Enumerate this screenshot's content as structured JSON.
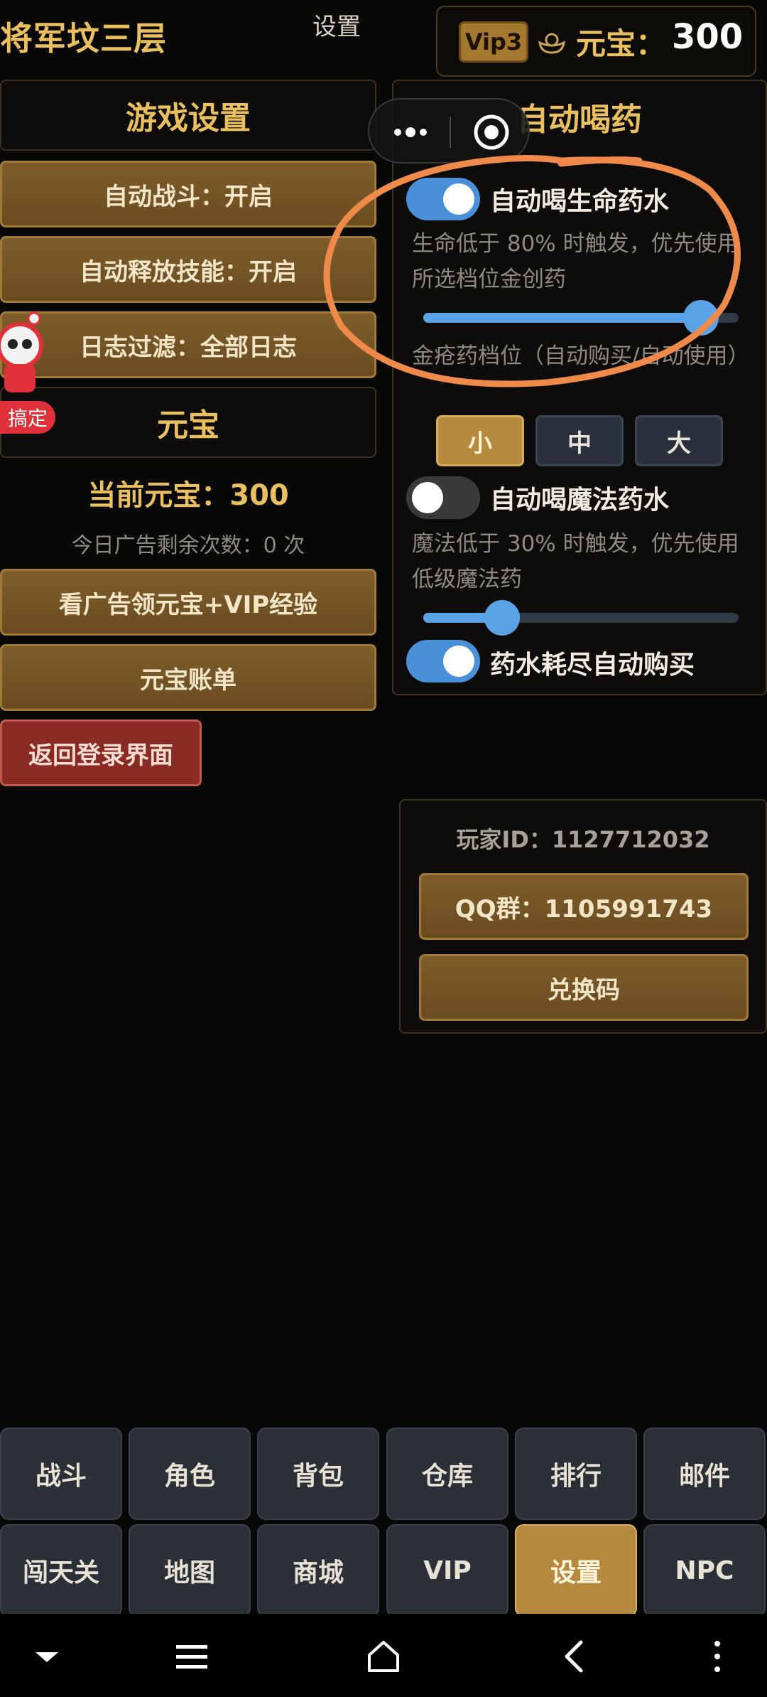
{
  "header": {
    "location": "将军坟三层",
    "tab_title": "设置",
    "vip_badge": "Vip3",
    "ingot_label": "元宝：",
    "ingot_value": "300"
  },
  "game_settings": {
    "title": "游戏设置",
    "auto_battle": "自动战斗：开启",
    "auto_skill": "自动释放技能：开启",
    "log_filter": "日志过滤：全部日志"
  },
  "mascot": {
    "tag": "搞定"
  },
  "ingot_panel": {
    "title": "元宝",
    "current": "当前元宝：300",
    "ads_left": "今日广告剩余次数：0 次",
    "watch_ad": "看广告领元宝+VIP经验",
    "ledger": "元宝账单"
  },
  "return_login": "返回登录界面",
  "auto_potion": {
    "title": "自动喝药",
    "hp": {
      "label": "自动喝生命药水",
      "on": true,
      "desc": "生命低于 80% 时触发，优先使用所选档位金创药",
      "slider_percent": 88
    },
    "tier_label": "金疮药档位（自动购买/自动使用）",
    "tiers": [
      "小",
      "中",
      "大"
    ],
    "tier_selected": "小",
    "mp": {
      "label": "自动喝魔法药水",
      "on": false,
      "desc": "魔法低于 30% 时触发，优先使用低级魔法药",
      "slider_percent": 25
    },
    "auto_buy": {
      "label": "药水耗尽自动购买",
      "on": true
    }
  },
  "account": {
    "player_id": "玩家ID：1127712032",
    "qq_group": "QQ群：1105991743",
    "redeem": "兑换码"
  },
  "nav": {
    "row1": [
      "战斗",
      "角色",
      "背包",
      "仓库",
      "排行",
      "邮件"
    ],
    "row2": [
      "闯天关",
      "地图",
      "商城",
      "VIP",
      "设置",
      "NPC"
    ],
    "active": "设置"
  },
  "colors": {
    "gold_text": "#e9bf5f",
    "accent_blue": "#5aa3e6",
    "annotation_orange": "#f08a4b"
  }
}
